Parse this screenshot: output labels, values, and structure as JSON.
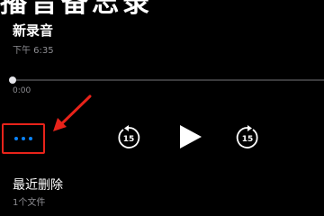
{
  "header": {
    "partial_title": "播音备忘录"
  },
  "recording": {
    "title": "新录音",
    "date": "下午 6:35",
    "elapsed": "0:00",
    "progress": 0
  },
  "controls": {
    "more_icon": "ellipsis-icon",
    "skip_back_icon": "skip-back-15-icon",
    "skip_back_seconds": "15",
    "play_icon": "play-icon",
    "skip_fwd_icon": "skip-forward-15-icon",
    "skip_fwd_seconds": "15"
  },
  "folder": {
    "title": "最近删除",
    "count": "1个文件"
  },
  "colors": {
    "accent": "#0a84ff",
    "highlight": "#e8231a",
    "secondary_text": "#8e8e93"
  }
}
